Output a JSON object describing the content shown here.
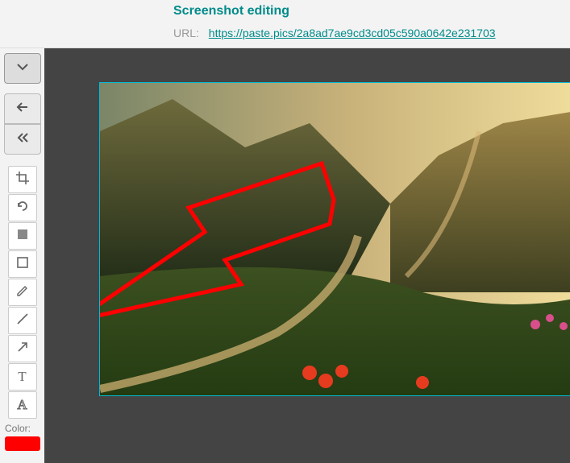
{
  "header": {
    "title": "Screenshot editing",
    "url_label": "URL:",
    "url_value": "https://paste.pics/2a8ad7ae9cd3cd05c590a0642e231703"
  },
  "toolbar": {
    "color_label": "Color:",
    "color_value": "#ff0000"
  },
  "annotation": {
    "stroke": "#ff0000"
  }
}
